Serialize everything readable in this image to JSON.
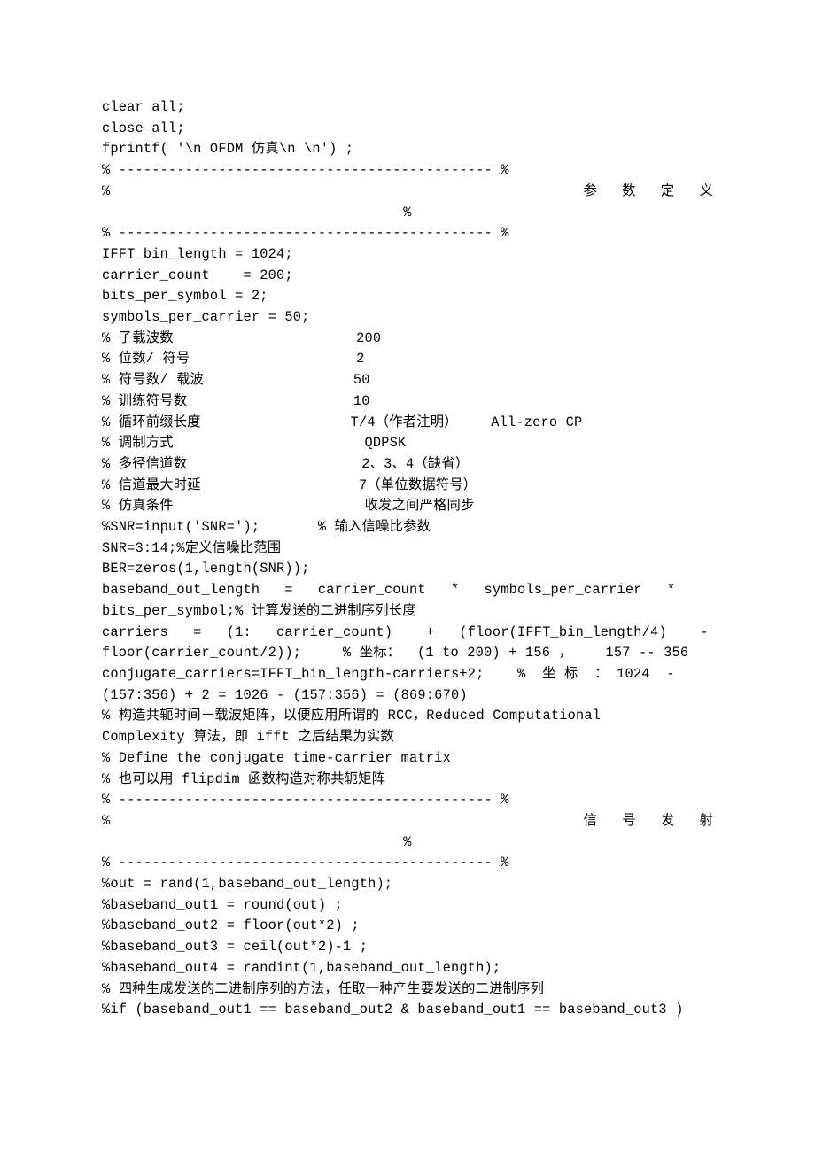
{
  "lines": {
    "l1": "clear all;",
    "l2": "close all;",
    "l3": "fprintf( '\\n OFDM 仿真\\n \\n') ;",
    "l4": "% --------------------------------------------- %",
    "l5a": "%",
    "l5b": "参   数   定   义",
    "l5c": "%",
    "l6": "% --------------------------------------------- %",
    "l7": "IFFT_bin_length = 1024;",
    "l8": "carrier_count    = 200;",
    "l9": "bits_per_symbol = 2;",
    "l10": "symbols_per_carrier = 50;",
    "l11": "% 子载波数                      200",
    "l12": "% 位数/ 符号                    2",
    "l13": "% 符号数/ 载波                  50",
    "l14": "% 训练符号数                    10",
    "l15": "% 循环前缀长度                  T/4（作者注明）    All-zero CP",
    "l16": "% 调制方式                       QDPSK",
    "l17": "% 多径信道数                     2、3、4（缺省）",
    "l18": "% 信道最大时延                   7（单位数据符号）",
    "l19": "% 仿真条件                       收发之间严格同步",
    "l20": "%SNR=input('SNR=');       % 输入信噪比参数",
    "l21": "SNR=3:14;%定义信噪比范围",
    "l22": "BER=zeros(1,length(SNR));",
    "l23": "baseband_out_length   =   carrier_count   *   symbols_per_carrier   *",
    "l24": "bits_per_symbol;% 计算发送的二进制序列长度",
    "l25": "carriers   =   (1:   carrier_count)    +   (floor(IFFT_bin_length/4)    -",
    "l26": "floor(carrier_count/2));     % 坐标：  (1 to 200) + 156 ，    157 -- 356",
    "l27": "conjugate_carriers=IFFT_bin_length-carriers+2;    %  坐 标  ： 1024  -",
    "l28": "(157:356) + 2 = 1026 - (157:356) = (869:670)",
    "l29": "% 构造共轭时间－载波矩阵，以便应用所谓的 RCC，Reduced Computational",
    "l30": "Complexity 算法，即 ifft 之后结果为实数",
    "l31": "% Define the conjugate time-carrier matrix",
    "l32": "% 也可以用 flipdim 函数构造对称共轭矩阵",
    "l33": "% --------------------------------------------- %",
    "l34a": "%",
    "l34b": "信   号   发   射",
    "l34c": "%",
    "l35": "% --------------------------------------------- %",
    "l36": "%out = rand(1,baseband_out_length);",
    "l37": "%baseband_out1 = round(out) ;",
    "l38": "%baseband_out2 = floor(out*2) ;",
    "l39": "%baseband_out3 = ceil(out*2)-1 ;",
    "l40": "%baseband_out4 = randint(1,baseband_out_length);",
    "l41": "% 四种生成发送的二进制序列的方法，任取一种产生要发送的二进制序列",
    "l42": "%if (baseband_out1 == baseband_out2 & baseband_out1 == baseband_out3 )"
  }
}
